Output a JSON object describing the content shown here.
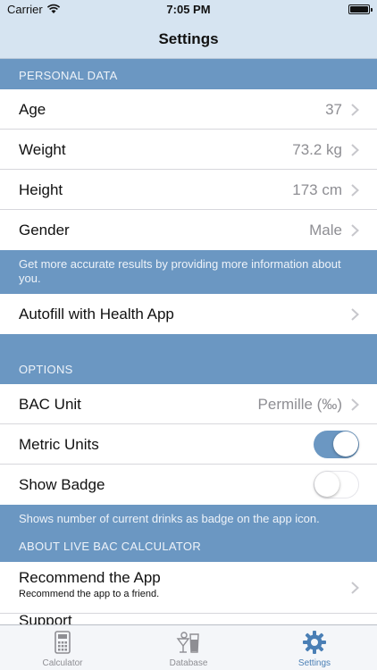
{
  "status_bar": {
    "carrier": "Carrier",
    "time": "7:05 PM"
  },
  "nav": {
    "title": "Settings"
  },
  "personal": {
    "header": "PERSONAL DATA",
    "rows": [
      {
        "label": "Age",
        "value": "37"
      },
      {
        "label": "Weight",
        "value": "73.2 kg"
      },
      {
        "label": "Height",
        "value": "173 cm"
      },
      {
        "label": "Gender",
        "value": "Male"
      }
    ],
    "footer": "Get more accurate results by providing more information about you."
  },
  "autofill": {
    "label": "Autofill with Health App"
  },
  "options": {
    "header": "OPTIONS",
    "bac_unit": {
      "label": "BAC Unit",
      "value": "Permille (‰)"
    },
    "metric_units": {
      "label": "Metric Units",
      "on": true
    },
    "show_badge": {
      "label": "Show Badge",
      "on": false
    },
    "footer": "Shows number of current drinks as badge on the app icon."
  },
  "about": {
    "header": "ABOUT LIVE BAC CALCULATOR",
    "recommend": {
      "label": "Recommend the App",
      "sublabel": "Recommend the app to a friend."
    },
    "support": {
      "label": "Support"
    }
  },
  "tabs": [
    {
      "label": "Calculator",
      "icon": "calculator-icon",
      "active": false
    },
    {
      "label": "Database",
      "icon": "drinks-icon",
      "active": false
    },
    {
      "label": "Settings",
      "icon": "gear-icon",
      "active": true
    }
  ],
  "colors": {
    "accent": "#6b97c2",
    "bars": "#d6e4f1",
    "active_tab": "#4a7fb5"
  }
}
